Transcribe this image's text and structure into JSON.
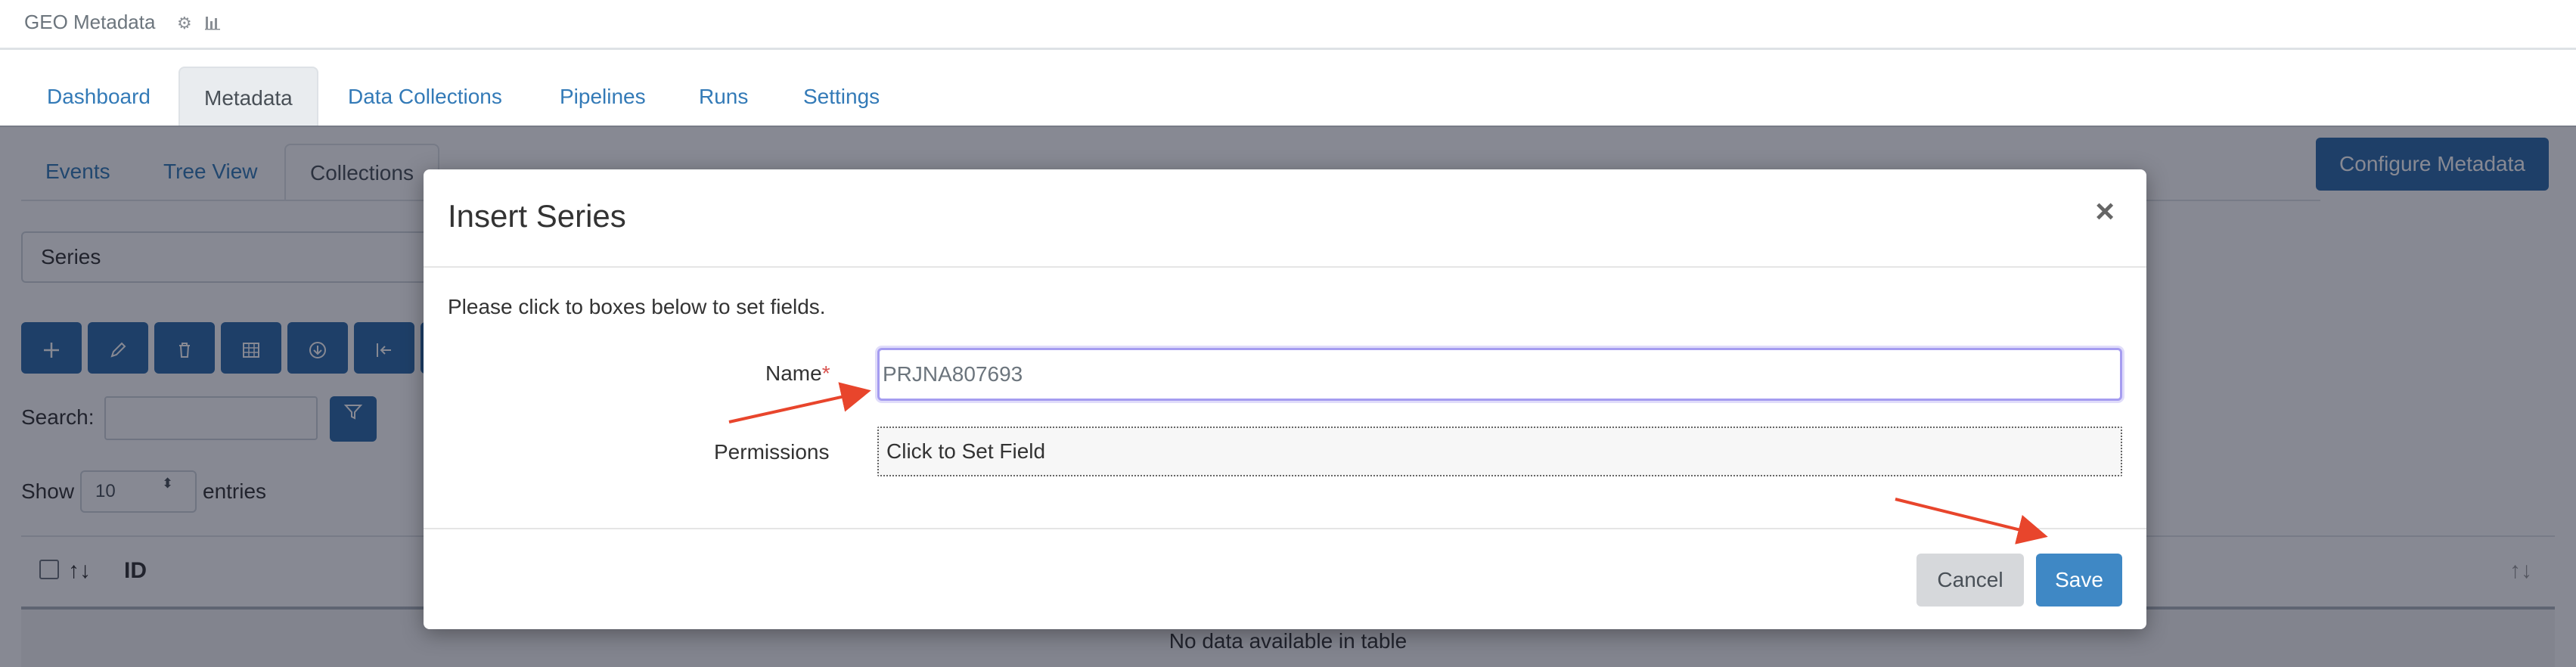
{
  "app": {
    "title": "GEO Metadata",
    "title_icons": [
      "gear-icon",
      "bar-chart-icon"
    ]
  },
  "main_tabs": [
    {
      "label": "Dashboard"
    },
    {
      "label": "Metadata",
      "active": true
    },
    {
      "label": "Data Collections"
    },
    {
      "label": "Pipelines"
    },
    {
      "label": "Runs"
    },
    {
      "label": "Settings"
    }
  ],
  "sub_tabs": [
    {
      "label": "Events"
    },
    {
      "label": "Tree View"
    },
    {
      "label": "Collections",
      "active": true
    }
  ],
  "configure_button": "Configure Metadata",
  "collection_select": "Series",
  "toolbar_icons": [
    "plus-icon",
    "pencil-icon",
    "trash-icon",
    "table-icon",
    "download-icon",
    "import-icon"
  ],
  "search": {
    "label": "Search:",
    "value": ""
  },
  "entries": {
    "show_label": "Show",
    "value": "10",
    "suffix": "entries"
  },
  "table": {
    "columns": [
      "ID"
    ],
    "empty_message": "No data available in table"
  },
  "modal": {
    "title": "Insert Series",
    "close": "×",
    "hint": "Please click to boxes below to set fields.",
    "fields": {
      "name_label": "Name",
      "name_required": "*",
      "name_value": "PRJNA807693",
      "permissions_label": "Permissions",
      "permissions_value": "Click to Set Field"
    },
    "cancel": "Cancel",
    "save": "Save"
  },
  "colors": {
    "primary_button": "#2c6aa8",
    "save_button": "#3f88c5",
    "link": "#337ab7",
    "annotation_arrow": "#e8452c",
    "required": "#d9534f"
  }
}
